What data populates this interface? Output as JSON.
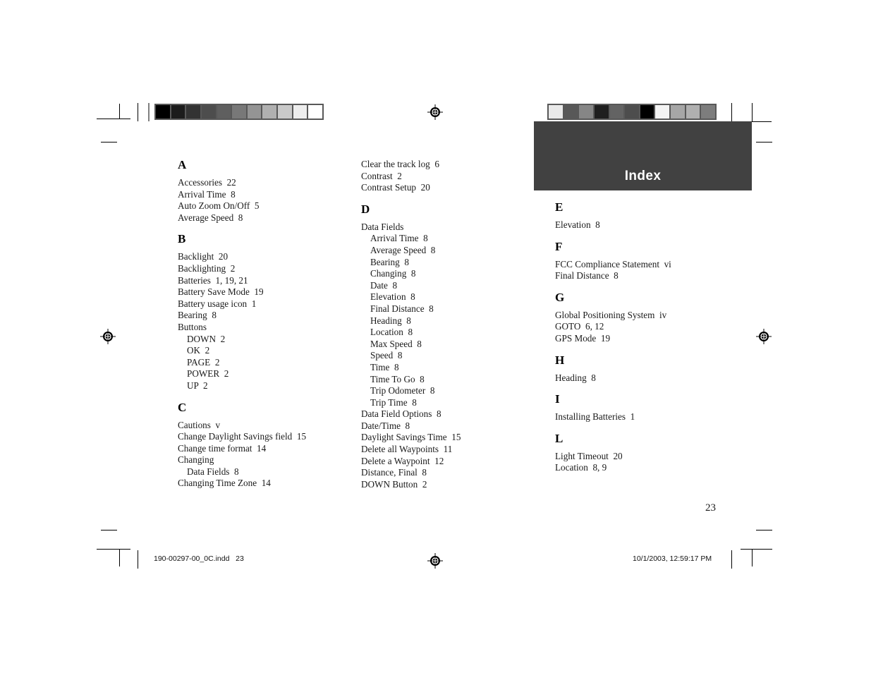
{
  "page": {
    "banner_title": "Index",
    "page_number": "23",
    "banner_color": "#414141",
    "banner_text_color": "#ffffff",
    "strip_background": "#585858"
  },
  "footer": {
    "file_slug": "190-00297-00_0C.indd   23",
    "timestamp_slug": "10/1/2003, 12:59:17 PM"
  },
  "color_strips": {
    "left": [
      "#000000",
      "#1c1c1c",
      "#333333",
      "#4d4d4d",
      "#5f5f5f",
      "#787878",
      "#949494",
      "#b0b0b0",
      "#c9c9c9",
      "#ededed",
      "#ffffff"
    ],
    "right": [
      "#e9e9e9",
      "#585858",
      "#868686",
      "#1f1f1f",
      "#636363",
      "#4d4d4d",
      "#000000",
      "#f4f4f4",
      "#a6a6a6",
      "#b0b0b0",
      "#7d7d7d"
    ]
  },
  "columns": [
    {
      "name": "column-1",
      "blocks": [
        {
          "letter": "A",
          "entries": [
            {
              "text": "Accessories  22",
              "sub": false
            },
            {
              "text": "Arrival Time  8",
              "sub": false
            },
            {
              "text": "Auto Zoom On/Off  5",
              "sub": false
            },
            {
              "text": "Average Speed  8",
              "sub": false
            }
          ]
        },
        {
          "letter": "B",
          "entries": [
            {
              "text": "Backlight  20",
              "sub": false
            },
            {
              "text": "Backlighting  2",
              "sub": false
            },
            {
              "text": "Batteries  1, 19, 21",
              "sub": false
            },
            {
              "text": "Battery Save Mode  19",
              "sub": false
            },
            {
              "text": "Battery usage icon  1",
              "sub": false
            },
            {
              "text": "Bearing  8",
              "sub": false
            },
            {
              "text": "Buttons",
              "sub": false
            },
            {
              "text": "DOWN  2",
              "sub": true
            },
            {
              "text": "OK  2",
              "sub": true
            },
            {
              "text": "PAGE  2",
              "sub": true
            },
            {
              "text": "POWER  2",
              "sub": true
            },
            {
              "text": "UP  2",
              "sub": true
            }
          ]
        },
        {
          "letter": "C",
          "entries": [
            {
              "text": "Cautions  v",
              "sub": false
            },
            {
              "text": "Change Daylight Savings field  15",
              "sub": false
            },
            {
              "text": "Change time format  14",
              "sub": false
            },
            {
              "text": "Changing",
              "sub": false
            },
            {
              "text": "Data Fields  8",
              "sub": true
            },
            {
              "text": "Changing Time Zone  14",
              "sub": false
            }
          ]
        }
      ]
    },
    {
      "name": "column-2",
      "blocks": [
        {
          "letter": "",
          "entries": [
            {
              "text": "Clear the track log  6",
              "sub": false
            },
            {
              "text": "Contrast  2",
              "sub": false
            },
            {
              "text": "Contrast Setup  20",
              "sub": false
            }
          ]
        },
        {
          "letter": "D",
          "entries": [
            {
              "text": "Data Fields",
              "sub": false
            },
            {
              "text": "Arrival Time  8",
              "sub": true
            },
            {
              "text": "Average Speed  8",
              "sub": true
            },
            {
              "text": "Bearing  8",
              "sub": true
            },
            {
              "text": "Changing  8",
              "sub": true
            },
            {
              "text": "Date  8",
              "sub": true
            },
            {
              "text": "Elevation  8",
              "sub": true
            },
            {
              "text": "Final Distance  8",
              "sub": true
            },
            {
              "text": "Heading  8",
              "sub": true
            },
            {
              "text": "Location  8",
              "sub": true
            },
            {
              "text": "Max Speed  8",
              "sub": true
            },
            {
              "text": "Speed  8",
              "sub": true
            },
            {
              "text": "Time  8",
              "sub": true
            },
            {
              "text": "Time To Go  8",
              "sub": true
            },
            {
              "text": "Trip Odometer  8",
              "sub": true
            },
            {
              "text": "Trip Time  8",
              "sub": true
            },
            {
              "text": "Data Field Options  8",
              "sub": false
            },
            {
              "text": "Date/Time  8",
              "sub": false
            },
            {
              "text": "Daylight Savings Time  15",
              "sub": false
            },
            {
              "text": "Delete all Waypoints  11",
              "sub": false
            },
            {
              "text": "Delete a Waypoint  12",
              "sub": false
            },
            {
              "text": "Distance, Final  8",
              "sub": false
            },
            {
              "text": "DOWN Button  2",
              "sub": false
            }
          ]
        }
      ]
    },
    {
      "name": "column-3",
      "blocks": [
        {
          "letter": "E",
          "entries": [
            {
              "text": "Elevation  8",
              "sub": false
            }
          ]
        },
        {
          "letter": "F",
          "entries": [
            {
              "text": "FCC Compliance Statement  vi",
              "sub": false
            },
            {
              "text": "Final Distance  8",
              "sub": false
            }
          ]
        },
        {
          "letter": "G",
          "entries": [
            {
              "text": "Global Positioning System  iv",
              "sub": false
            },
            {
              "text": "GOTO  6, 12",
              "sub": false
            },
            {
              "text": "GPS Mode  19",
              "sub": false
            }
          ]
        },
        {
          "letter": "H",
          "entries": [
            {
              "text": "Heading  8",
              "sub": false
            }
          ]
        },
        {
          "letter": "I",
          "entries": [
            {
              "text": "Installing Batteries  1",
              "sub": false
            }
          ]
        },
        {
          "letter": "L",
          "entries": [
            {
              "text": "Light Timeout  20",
              "sub": false
            },
            {
              "text": "Location  8, 9",
              "sub": false
            }
          ]
        }
      ]
    }
  ]
}
